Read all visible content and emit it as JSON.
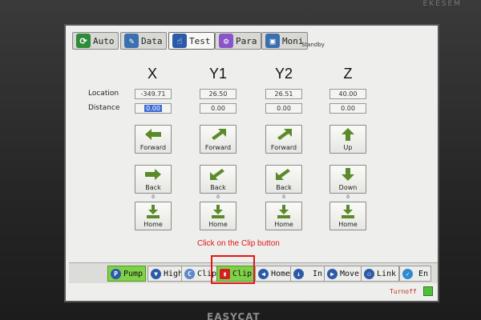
{
  "brand_top": "EKESEM",
  "brand_bottom": "EASYCAT",
  "tabs": [
    {
      "label": "Auto",
      "icon": "auto-icon",
      "color": "#2e8b3a"
    },
    {
      "label": "Data",
      "icon": "data-icon",
      "color": "#3a6fb0"
    },
    {
      "label": "Test",
      "icon": "hand-icon",
      "color": "#2c5aa8"
    },
    {
      "label": "Para",
      "icon": "para-icon",
      "color": "#8a55c8"
    },
    {
      "label": "Moni",
      "icon": "monitor-icon",
      "color": "#3a6fb0"
    }
  ],
  "status": "Standby",
  "axes": {
    "headers": [
      "X",
      "Y1",
      "Y2",
      "Z"
    ],
    "location_label": "Location",
    "distance_label": "Distance",
    "location": [
      "-349.71",
      "26.50",
      "26.51",
      "40.00"
    ],
    "distance": [
      "0.00",
      "0.00",
      "0.00",
      "0.00"
    ],
    "forward": [
      "Forward",
      "Forward",
      "Forward",
      "Up"
    ],
    "back": [
      "Back",
      "Back",
      "Back",
      "Down"
    ],
    "home": [
      "Home",
      "Home",
      "Home",
      "Home"
    ],
    "zero": [
      "0",
      "0",
      "0",
      "0"
    ]
  },
  "toolbar": [
    {
      "label": "Pump",
      "icon": "pump-icon",
      "active": true
    },
    {
      "label": "High",
      "icon": "pin-icon"
    },
    {
      "label": "Clip",
      "icon": "clip-icon"
    },
    {
      "label": "Clip",
      "icon": "clip-red-icon",
      "active": true
    },
    {
      "label": "Home",
      "icon": "home-arrow-icon"
    },
    {
      "label": "In",
      "icon": "in-icon"
    },
    {
      "label": "Move",
      "icon": "move-icon"
    },
    {
      "label": "Link",
      "icon": "link-icon"
    },
    {
      "label": "En",
      "icon": "check-icon"
    }
  ],
  "annotation": "Click on the Clip button",
  "turnoff": "Turnoff",
  "colors": {
    "accent_green": "#7fd14a",
    "annotation_red": "#e01818",
    "led_green": "#4fbf3a"
  }
}
